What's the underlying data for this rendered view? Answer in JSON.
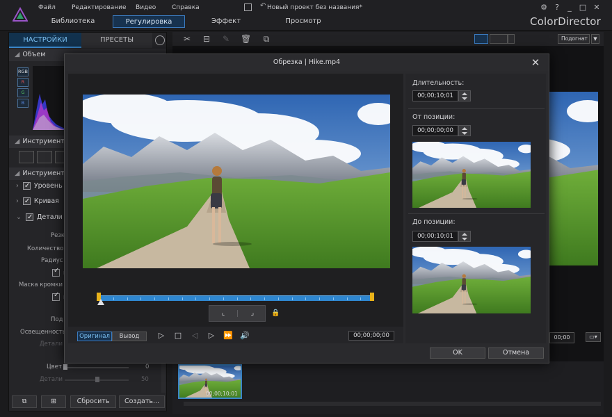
{
  "app": {
    "menu": [
      "Файл",
      "Редактирование",
      "Видео",
      "Справка"
    ],
    "project_title": "Новый проект без названия*",
    "tabs": [
      "Библиотека",
      "Регулировка",
      "Эффект",
      "Просмотр"
    ],
    "active_tab": "Регулировка",
    "brand": "ColorDirector",
    "window_controls": [
      "?",
      "_",
      "□",
      "✕"
    ]
  },
  "left_panel": {
    "tabs": [
      "НАСТРОЙКИ",
      "ПРЕСЕТЫ"
    ],
    "sections": {
      "volume": "Объем",
      "tools1": "Инструменты",
      "tools2": "Инструменты"
    },
    "channels": [
      "RGB",
      "R",
      "G",
      "B"
    ],
    "items": [
      "Уровень",
      "Кривая",
      "Детали"
    ],
    "params": {
      "sharpen": "Резк",
      "amount": "Количество",
      "radius": "Радиус",
      "edge_mask": "Маска кромки",
      "sub": "Под",
      "lightness": "Освещенность",
      "details1": "Детали",
      "color": "Цвет",
      "details2": "Детали",
      "color_val": "0",
      "details2_val": "50",
      "cb_p1": "п",
      "cb_p2": "п"
    },
    "footer": {
      "reset": "Сбросить",
      "create": "Создать..."
    }
  },
  "toolbar": {
    "fit": "Подогнат",
    "fit_arrow": "▼"
  },
  "workspace": {
    "timecode": "00;00",
    "screen_icon": "▭▾"
  },
  "library": {
    "clip_timecode": "00;00;10;01"
  },
  "dialog": {
    "title": "Обрезка | Hike.mp4",
    "close": "✕",
    "view_original": "Оригинал",
    "view_output": "Вывод",
    "current_timecode": "00;00;00;00",
    "duration_label": "Длительность:",
    "duration": "00;00;10;01",
    "from_label": "От позиции:",
    "from_tc": "00;00;00;00",
    "to_label": "До позиции:",
    "to_tc": "00;00;10;01",
    "ok": "OK",
    "cancel": "Отмена",
    "trim_start_fraction": 0.0,
    "trim_end_fraction": 1.0,
    "playhead_fraction": 0.0
  },
  "colors": {
    "accent": "#3a86c8",
    "marker": "#e8b21a",
    "trim_bar": "#2f87d0"
  }
}
